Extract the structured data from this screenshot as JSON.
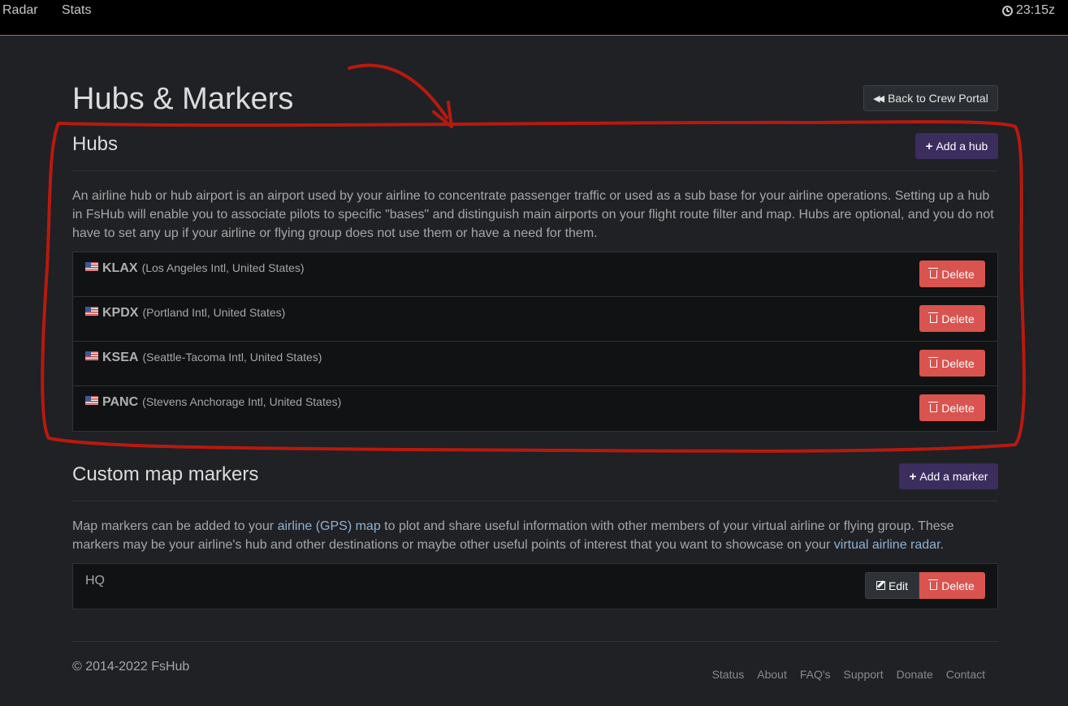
{
  "nav": {
    "radar": "Radar",
    "stats": "Stats",
    "clock": "23:15z"
  },
  "page": {
    "title": "Hubs & Markers",
    "back_button": "Back to Crew Portal"
  },
  "hubs": {
    "title": "Hubs",
    "add_button": "Add a hub",
    "description": "An airline hub or hub airport is an airport used by your airline to concentrate passenger traffic or used as a sub base for your airline operations. Setting up a hub in FsHub will enable you to associate pilots to specific \"bases\" and distinguish main airports on your flight route filter and map. Hubs are optional, and you do not have to set any up if your airline or flying group does not use them or have a need for them.",
    "items": [
      {
        "code": "KLAX",
        "desc": "(Los Angeles Intl, United States)",
        "delete": "Delete"
      },
      {
        "code": "KPDX",
        "desc": "(Portland Intl, United States)",
        "delete": "Delete"
      },
      {
        "code": "KSEA",
        "desc": "(Seattle-Tacoma Intl, United States)",
        "delete": "Delete"
      },
      {
        "code": "PANC",
        "desc": "(Stevens Anchorage Intl, United States)",
        "delete": "Delete"
      }
    ]
  },
  "markers": {
    "title": "Custom map markers",
    "add_button": "Add a marker",
    "desc_part1": "Map markers can be added to your ",
    "link1": "airline (GPS) map",
    "desc_part2": " to plot and share useful information with other members of your virtual airline or flying group. These markers may be your airline's hub and other destinations or maybe other useful points of interest that you want to showcase on your ",
    "link2": "virtual airline radar",
    "desc_part3": ".",
    "items": [
      {
        "name": "HQ",
        "edit": "Edit",
        "delete": "Delete"
      }
    ]
  },
  "footer": {
    "copyright": "© 2014-2022 FsHub",
    "links": [
      "Status",
      "About",
      "FAQ's",
      "Support",
      "Donate",
      "Contact"
    ]
  },
  "colors": {
    "accent_orange": "#c2602f",
    "purple": "#3b2d5e",
    "danger": "#d9534f",
    "annotation_red": "#b8190f"
  }
}
